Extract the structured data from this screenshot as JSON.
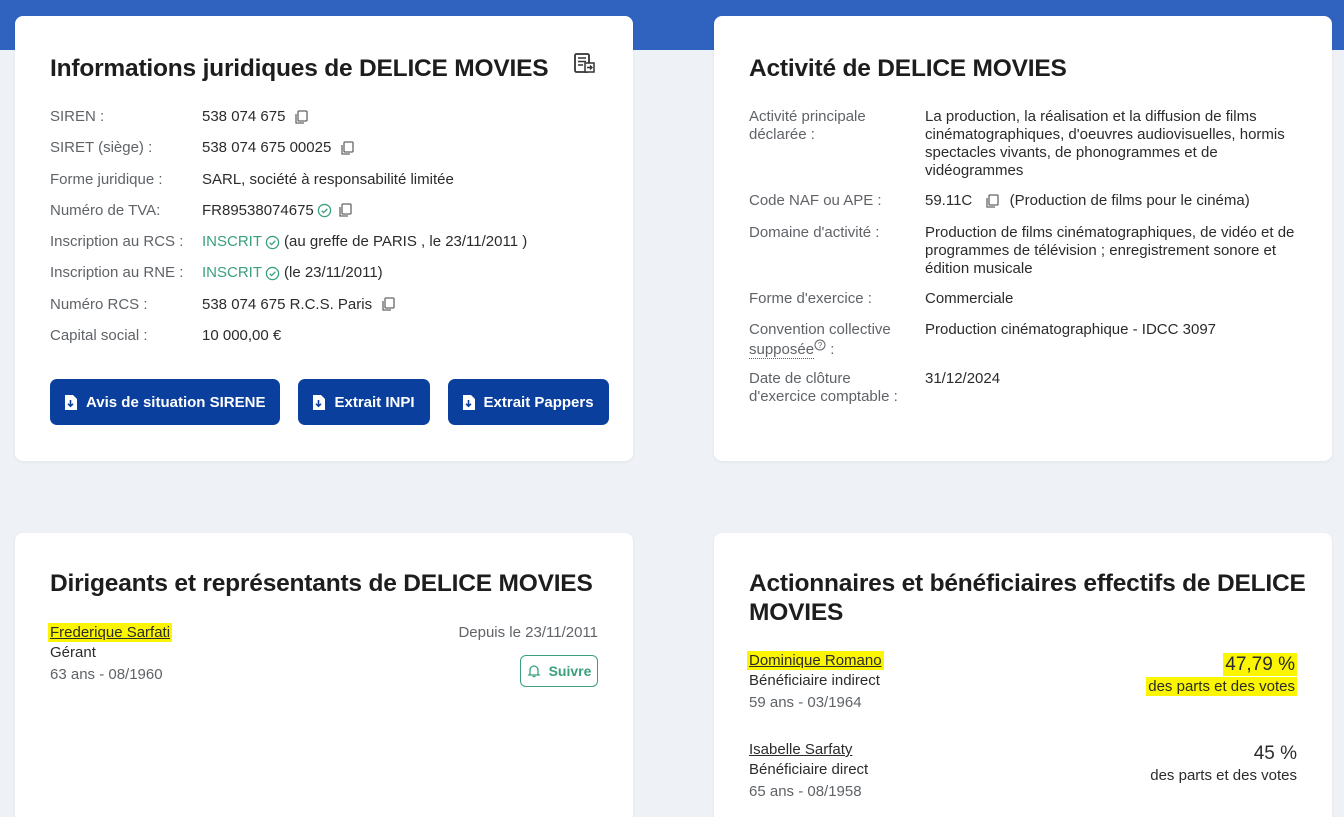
{
  "legal": {
    "title": "Informations juridiques de DELICE MOVIES",
    "siren_label": "SIREN :",
    "siren": "538 074 675",
    "siret_label": "SIRET (siège) :",
    "siret": "538 074 675 00025",
    "forme_label": "Forme juridique :",
    "forme": "SARL, société à responsabilité limitée",
    "tva_label": "Numéro de TVA:",
    "tva": "FR89538074675",
    "rcs_label": "Inscription au RCS :",
    "rcs_status": "INSCRIT",
    "rcs_detail": "(au greffe de PARIS , le 23/11/2011 )",
    "rne_label": "Inscription au RNE :",
    "rne_status": "INSCRIT",
    "rne_detail": "(le 23/11/2011)",
    "num_rcs_label": "Numéro RCS :",
    "num_rcs": "538 074 675 R.C.S. Paris",
    "capital_label": "Capital social :",
    "capital": "10 000,00 €",
    "buttons": [
      "Avis de situation SIRENE",
      "Extrait INPI",
      "Extrait Pappers"
    ]
  },
  "activity": {
    "title": "Activité de DELICE MOVIES",
    "principale_label": "Activité principale déclarée :",
    "principale": "La production, la réalisation et la diffusion de films cinématographiques, d'oeuvres audiovisuelles, hormis spectacles vivants, de phonogrammes et de vidéogrammes",
    "naf_label": "Code NAF ou APE :",
    "naf": "59.11C",
    "naf_desc": "(Production de films pour le cinéma)",
    "domaine_label": "Domaine d'activité :",
    "domaine": "Production de films cinématographiques, de vidéo et de programmes de télévision ; enregistrement sonore et édition musicale",
    "exercice_label": "Forme d'exercice :",
    "exercice": "Commerciale",
    "convention_label_1": "Convention collective",
    "convention_label_2": "supposée",
    "convention_label_3": " :",
    "convention": "Production cinématographique - IDCC 3097",
    "cloture_label": "Date de clôture d'exercice comptable :",
    "cloture": "31/12/2024"
  },
  "leaders": {
    "title": "Dirigeants et représentants de DELICE MOVIES",
    "name": "Frederique Sarfati",
    "role": "Gérant",
    "age": "63 ans - 08/1960",
    "since": "Depuis le 23/11/2011",
    "follow": "Suivre"
  },
  "shareholders": {
    "title_line1": "Actionnaires et bénéficiaires effectifs de DELICE",
    "title_line2": "MOVIES",
    "items": [
      {
        "name": "Dominique Romano",
        "role": "Bénéficiaire indirect",
        "age": "59 ans - 03/1964",
        "percent": "47,79 %",
        "detail": "des parts et des votes"
      },
      {
        "name": "Isabelle Sarfaty",
        "role": "Bénéficiaire direct",
        "age": "65 ans - 08/1958",
        "percent": "45 %",
        "detail": "des parts et des votes"
      }
    ]
  }
}
